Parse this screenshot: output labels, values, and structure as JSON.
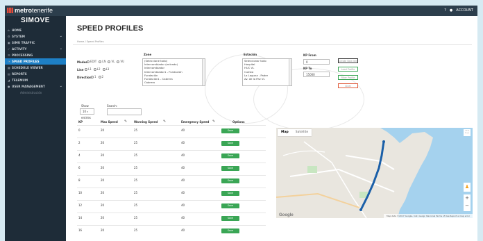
{
  "topbar": {
    "brand_prefix": "metro",
    "brand_suffix": "tenerife",
    "help": "?",
    "account": "ACCOUNT"
  },
  "sidebar": {
    "app_name": "SIMOVE",
    "items": [
      {
        "label": "HOME",
        "icon": "home-icon"
      },
      {
        "label": "SYSTEM",
        "icon": "gear-icon",
        "chevron": "⌄"
      },
      {
        "label": "SIMU TRAFFIC",
        "icon": "train-icon"
      },
      {
        "label": "ACTIVITY",
        "icon": "activity-icon",
        "chevron": "⌄"
      },
      {
        "label": "PROCESSING",
        "icon": "list-icon"
      },
      {
        "label": "SPEED PROFILES",
        "icon": "speed-icon"
      },
      {
        "label": "SCHEDULE VIEWER",
        "icon": "grid-icon"
      },
      {
        "label": "REPORTS",
        "icon": "report-icon"
      },
      {
        "label": "TELEMUM",
        "icon": "signal-icon"
      },
      {
        "label": "USER MANAGEMENT",
        "icon": "user-icon",
        "chevron": "⌄"
      }
    ],
    "sub_item": "Administración"
  },
  "main": {
    "title": "SPEED PROFILES",
    "breadcrumb": "Home / Speed Profiles",
    "filters": {
      "modes_label": "Modes",
      "modes": [
        "EDIT",
        "LN",
        "VL",
        "VU"
      ],
      "line_label": "Line",
      "lines": [
        "L1",
        "L2",
        "L3"
      ],
      "direction_label": "Direction",
      "directions": [
        "1",
        "2"
      ]
    },
    "zone": {
      "label": "Zone",
      "options": [
        "(Seleccione todo)",
        "Intercambiador (entrada)",
        "Intercambiador",
        "Intercambiador1 - Fundación",
        "Fundación",
        "Fundación1 - Cabrera",
        "Cabrera"
      ]
    },
    "station": {
      "label": "Estación",
      "options": [
        "Seleccionar todo",
        "Hospital",
        "HUC VL",
        "Cuesta",
        "La Laguna - Padre",
        "Av. de la Paz VL"
      ]
    },
    "kp_from": {
      "label": "KP From",
      "value": "0"
    },
    "kp_to": {
      "label": "KP To",
      "value": "15000"
    },
    "actions": [
      "Create New Version",
      "Load Profile",
      "Filter Profile",
      "Clear"
    ],
    "show": {
      "label": "Show",
      "value": "10",
      "entries": "entries"
    },
    "search": {
      "label": "Search:",
      "placeholder": ""
    },
    "table": {
      "headers": [
        "KP",
        "Max Speed",
        "Warning Speed",
        "Emergency Speed",
        "Options"
      ],
      "save_label": "Save",
      "rows": [
        [
          "0",
          "20",
          "25",
          "40"
        ],
        [
          "2",
          "20",
          "25",
          "40"
        ],
        [
          "4",
          "20",
          "25",
          "40"
        ],
        [
          "6",
          "20",
          "25",
          "40"
        ],
        [
          "8",
          "20",
          "25",
          "40"
        ],
        [
          "10",
          "20",
          "25",
          "40"
        ],
        [
          "12",
          "20",
          "25",
          "40"
        ],
        [
          "14",
          "20",
          "25",
          "40"
        ],
        [
          "16",
          "20",
          "25",
          "40"
        ]
      ]
    },
    "map": {
      "tabs": [
        "Map",
        "Satellite"
      ],
      "footer": "Map data ©2017 Google, Inst. Geogr. Nacional   Terms of Use   Report a map error",
      "colors": {
        "water": "#a5d2ee",
        "land": "#e9e6df",
        "route": "#1a5fa8"
      }
    }
  }
}
